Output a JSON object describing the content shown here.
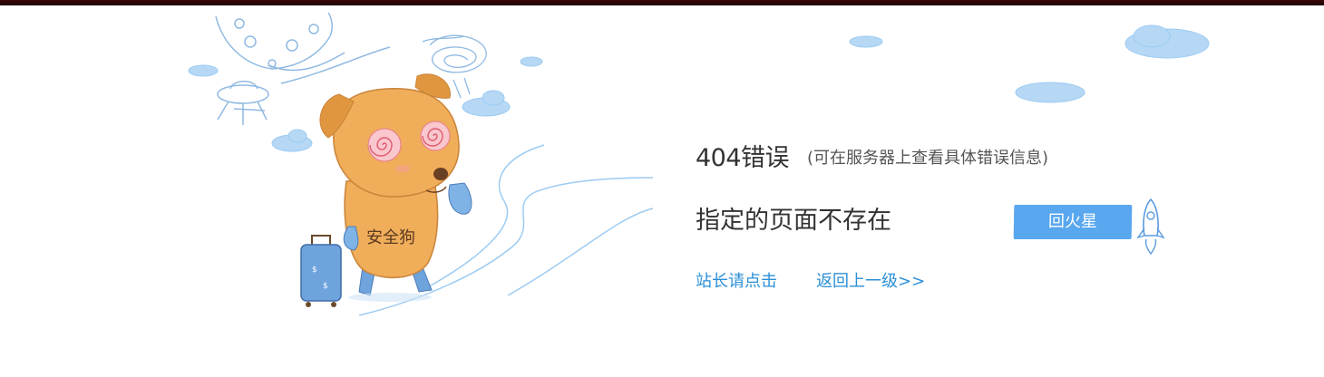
{
  "error": {
    "title": "404错误",
    "note": "(可在服务器上查看具体错误信息)",
    "message": "指定的页面不存在"
  },
  "links": {
    "admin": "站长请点击",
    "back": "返回上一级>>"
  },
  "button": {
    "label": "回火星"
  },
  "mascot": {
    "belly_text": "安全狗"
  },
  "colors": {
    "link": "#2b8fd6",
    "button": "#58a7ef",
    "cloud": "#9ccbf2",
    "dog": "#f0ad5a",
    "top_bar": "#2a0606"
  },
  "icons": [
    "ufo-icon",
    "moon-icon",
    "suitcase-icon",
    "rocket-icon",
    "cloud-icon"
  ]
}
